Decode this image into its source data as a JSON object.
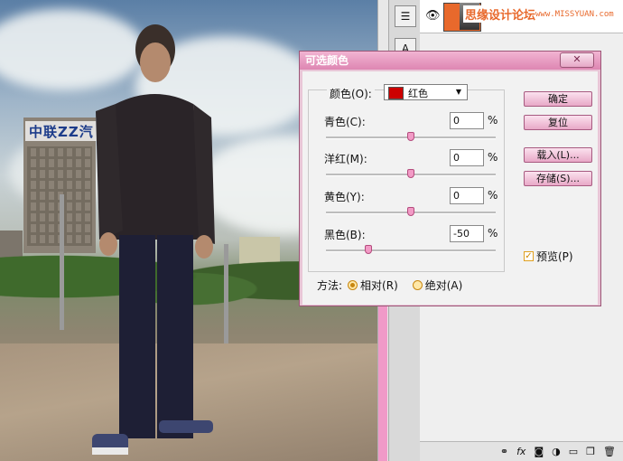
{
  "dialog": {
    "title": "可选颜色",
    "colors_label": "颜色(O):",
    "selected_color": "红色",
    "selected_color_hex": "#cc0000",
    "rows": [
      {
        "label": "青色(C):",
        "value": "0",
        "unit": "%",
        "slider_fraction": 0.5
      },
      {
        "label": "洋红(M):",
        "value": "0",
        "unit": "%",
        "slider_fraction": 0.5
      },
      {
        "label": "黄色(Y):",
        "value": "0",
        "unit": "%",
        "slider_fraction": 0.5
      },
      {
        "label": "黑色(B):",
        "value": "-50",
        "unit": "%",
        "slider_fraction": 0.25
      }
    ],
    "buttons": {
      "ok": "确定",
      "reset": "复位",
      "load": "载入(L)...",
      "save": "存储(S)..."
    },
    "preview_label": "预览(P)",
    "preview_checked": true,
    "method_label": "方法:",
    "method_options": [
      {
        "label": "相对(R)",
        "selected": true
      },
      {
        "label": "绝对(A)",
        "selected": false
      }
    ]
  },
  "layers_panel": {
    "watermark": "思缘设计论坛",
    "watermark_url": "www.MISSYUAN.com"
  },
  "accent_color": "#de86b2"
}
